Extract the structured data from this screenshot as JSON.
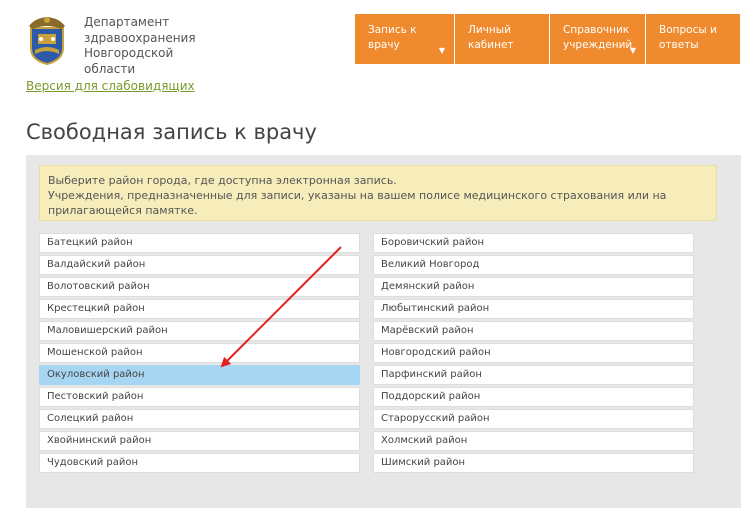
{
  "header": {
    "org_lines": [
      "Департамент",
      "здравоохранения",
      "Новгородской",
      "области"
    ],
    "accessibility_link": "Версия для слабовидящих",
    "logo_icon": "novgorod-coat-of-arms-icon"
  },
  "nav": {
    "tabs": [
      {
        "lines": [
          "Запись к",
          "врачу"
        ],
        "has_dropdown": true
      },
      {
        "lines": [
          "Личный",
          "кабинет"
        ],
        "has_dropdown": false
      },
      {
        "lines": [
          "Справочник",
          "учреждений"
        ],
        "has_dropdown": true
      },
      {
        "lines": [
          "Вопросы и",
          "ответы"
        ],
        "has_dropdown": false
      }
    ],
    "accent_color": "#ef8a2e"
  },
  "main": {
    "title": "Свободная запись к врачу",
    "notice_lines": [
      "Выберите район города, где доступна электронная запись.",
      "Учреждения, предназначенные для записи, указаны на вашем полисе медицинского страхования или на",
      "прилагающейся памятке."
    ],
    "districts_left": [
      "Батецкий район",
      "Валдайский район",
      "Волотовский район",
      "Крестецкий район",
      "Маловишерский район",
      "Мошенской район",
      "Окуловский район",
      "Пестовский район",
      "Солецкий район",
      "Хвойнинский район",
      "Чудовский район"
    ],
    "districts_right": [
      "Боровичский район",
      "Великий Новгород",
      "Демянский район",
      "Любытинский район",
      "Марёвский район",
      "Новгородский район",
      "Парфинский район",
      "Поддорский район",
      "Старорусский район",
      "Холмский район",
      "Шимский район"
    ],
    "selected_district": "Окуловский район",
    "highlight_color": "#a6d6f1",
    "annotation_color": "#e32020"
  }
}
